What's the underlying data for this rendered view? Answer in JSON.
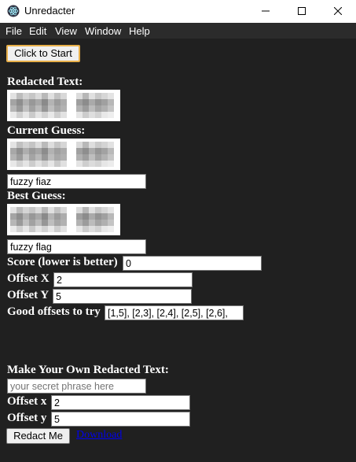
{
  "window": {
    "title": "Unredacter",
    "icon": "electron-atom-icon",
    "controls": [
      "minimize-icon",
      "maximize-icon",
      "close-icon"
    ]
  },
  "menu": {
    "items": [
      "File",
      "Edit",
      "View",
      "Window",
      "Help"
    ]
  },
  "main": {
    "start_button": "Click to Start",
    "redacted_label": "Redacted Text:",
    "current_guess_label": "Current Guess:",
    "current_guess_value": "fuzzy fiaz",
    "best_guess_label": "Best Guess:",
    "best_guess_value": "fuzzy flag",
    "score_label": "Score (lower is better)",
    "score_value": "0",
    "offset_x_label": "Offset X",
    "offset_x_value": "2",
    "offset_y_label": "Offset Y",
    "offset_y_value": "5",
    "good_offsets_label": "Good offsets to try",
    "good_offsets_value": "[1,5], [2,3], [2,4], [2,5], [2,6],"
  },
  "make_own": {
    "heading": "Make Your Own Redacted Text:",
    "phrase_placeholder": "your secret phrase here",
    "offset_x_label": "Offset x",
    "offset_x_value": "2",
    "offset_y_label": "Offset y",
    "offset_y_value": "5",
    "redact_button": "Redact Me",
    "download_link": "Download"
  },
  "colors": {
    "background": "#202020",
    "menubar": "#2b2b2b",
    "focus_border": "#e8b04a",
    "link": "#0000ee"
  }
}
